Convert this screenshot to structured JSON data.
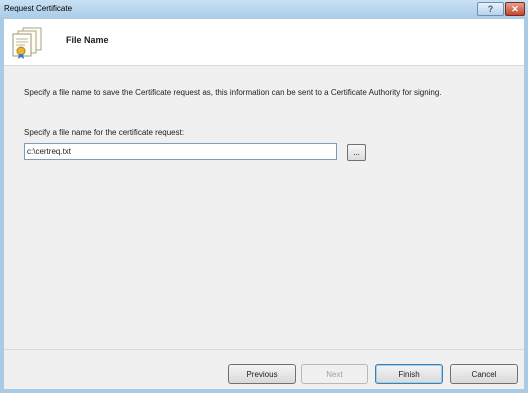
{
  "window": {
    "title": "Request Certificate",
    "help_label": "?",
    "close_label": "✕"
  },
  "header": {
    "title": "File Name",
    "icon": "certificate-icon"
  },
  "body": {
    "description": "Specify a file name to save the Certificate request as, this information can be sent to a Certificate Authority for signing.",
    "field_label": "Specify a file name for the certificate request:",
    "file_path_value": "c:\\certreq.txt",
    "browse_label": "..."
  },
  "buttons": {
    "previous": "Previous",
    "next": "Next",
    "finish": "Finish",
    "cancel": "Cancel"
  },
  "colors": {
    "frame": "#a9cbe6",
    "close": "#c3462f"
  }
}
